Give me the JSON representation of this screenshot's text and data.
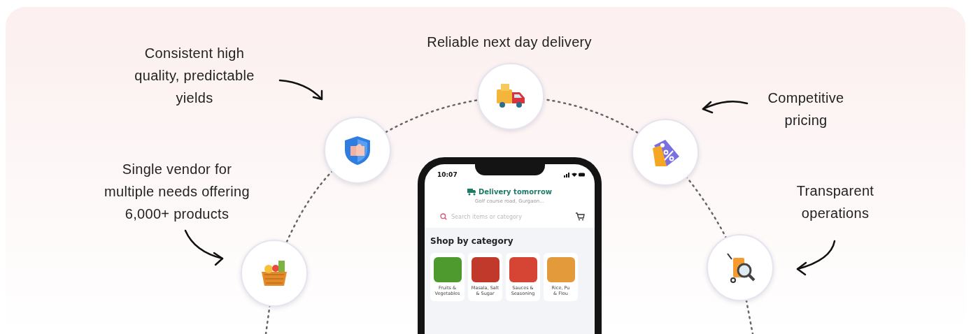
{
  "benefits": [
    {
      "kind": "delivery",
      "label": "Reliable next day delivery"
    },
    {
      "kind": "quality",
      "label": "Consistent high\nquality, predictable\nyields"
    },
    {
      "kind": "pricing",
      "label": "Competitive\npricing"
    },
    {
      "kind": "range",
      "label": "Single vendor for\nmultiple needs offering\n6,000+ products"
    },
    {
      "kind": "transparency",
      "label": "Transparent\noperations"
    }
  ],
  "phone": {
    "time": "10:07",
    "header": "Delivery tomorrow",
    "address": "Golf course road, Gurgaon...",
    "search": {
      "placeholder": "Search items or category"
    },
    "section_title": "Shop by category",
    "categories": [
      {
        "label": "Fruits &\nVegetables",
        "color": "#4e9a2e"
      },
      {
        "label": "Masala, Salt\n& Sugar",
        "color": "#c0392b"
      },
      {
        "label": "Sauces &\nSeasoning",
        "color": "#d64533"
      },
      {
        "label": "Rice, Pu\n& Flou",
        "color": "#e39a3b"
      }
    ]
  }
}
